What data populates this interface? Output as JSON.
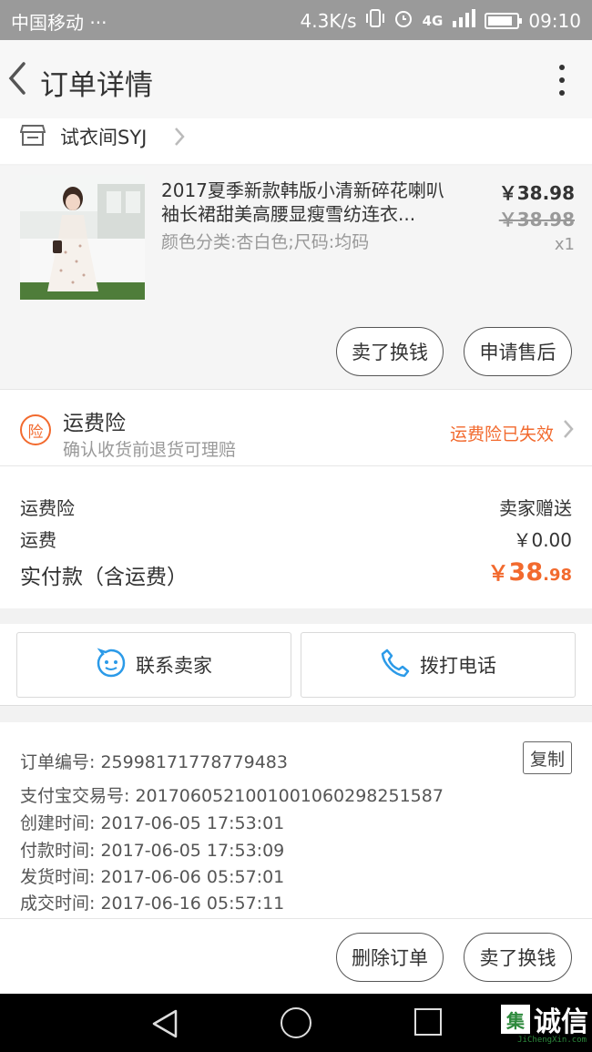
{
  "status_bar": {
    "carrier": "中国移动 ···",
    "speed": "4.3K/s",
    "network": "4G",
    "battery_level": 0.85,
    "time": "09:10"
  },
  "header": {
    "title": "订单详情"
  },
  "shop": {
    "name": "试衣间SYJ"
  },
  "product": {
    "title": "2017夏季新款韩版小清新碎花喇叭袖长裙甜美高腰显瘦雪纺连衣...",
    "sku": "颜色分类:杏白色;尺码:均码",
    "price": "￥38.98",
    "original_price": "￥38.98",
    "quantity": "x1",
    "sell_button": "卖了换钱",
    "after_sale_button": "申请售后"
  },
  "insurance": {
    "icon_char": "险",
    "title": "运费险",
    "subtitle": "确认收货前退货可理赔",
    "status": "运费险已失效"
  },
  "fees": {
    "insurance_label": "运费险",
    "insurance_value": "卖家赠送",
    "shipping_label": "运费",
    "shipping_value": "￥0.00",
    "total_label": "实付款（含运费）",
    "total_currency": "￥",
    "total_int": "38",
    "total_dec": ".98"
  },
  "contact": {
    "seller_label": "联系卖家",
    "call_label": "拨打电话"
  },
  "order_info": {
    "order_no_label": "订单编号:",
    "order_no": "25998171778779483",
    "copy_label": "复制",
    "alipay_label": "支付宝交易号:",
    "alipay_no": "2017060521001001060298251587",
    "created_label": "创建时间:",
    "created": "2017-06-05 17:53:01",
    "paid_label": "付款时间:",
    "paid": "2017-06-05 17:53:09",
    "shipped_label": "发货时间:",
    "shipped": "2017-06-06 05:57:01",
    "closed_label": "成交时间:",
    "closed": "2017-06-16 05:57:11"
  },
  "bottom_actions": {
    "delete_label": "删除订单",
    "sell_label": "卖了换钱"
  },
  "watermark": {
    "box": "集",
    "text": "诚信",
    "sub": "JiChengXin.com"
  },
  "colors": {
    "accent": "#f26a2e",
    "contact_blue": "#2b9ae8"
  }
}
